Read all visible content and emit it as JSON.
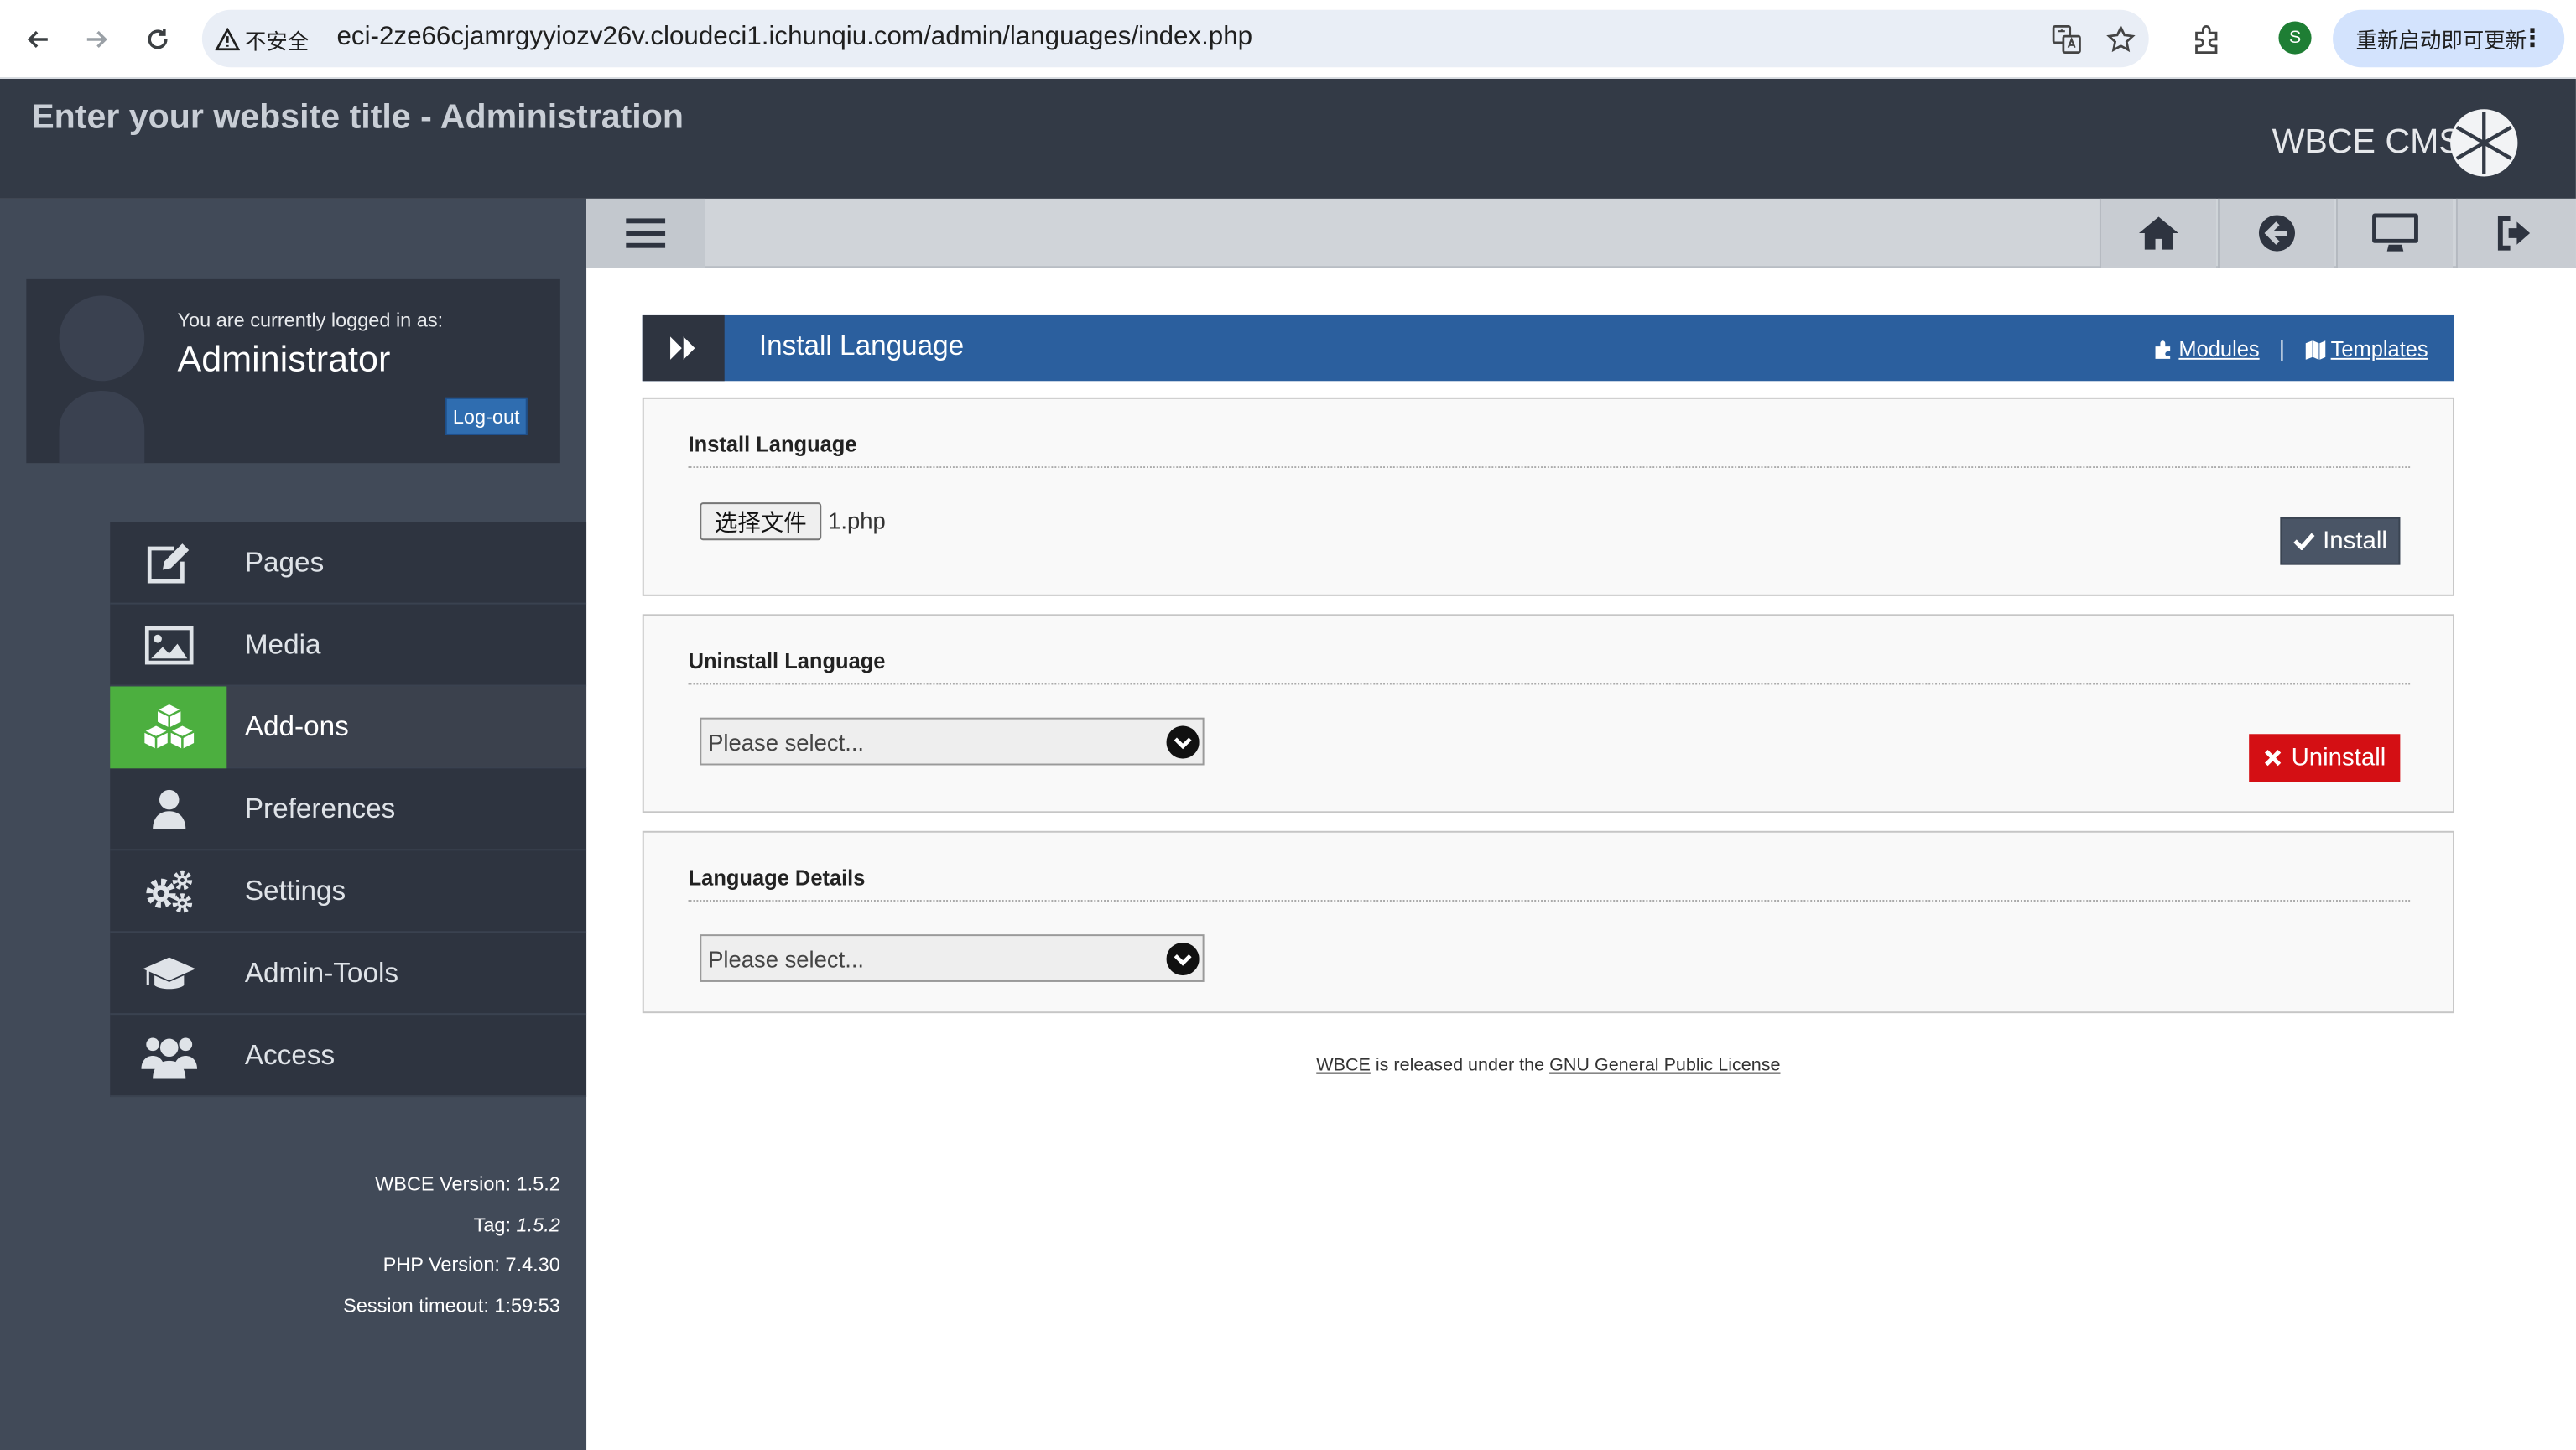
{
  "browser": {
    "security_label": "不安全",
    "url": "eci-2ze66cjamrgyyiozv26v.cloudeci1.ichunqiu.com/admin/languages/index.php",
    "profile_initial": "S",
    "update_label": "重新启动即可更新"
  },
  "header": {
    "site_title": "Enter your website title - Administration",
    "brand": "WBCE CMS"
  },
  "user": {
    "logged_in_label": "You are currently logged in as:",
    "name": "Administrator",
    "logout_label": "Log-out"
  },
  "menu": [
    {
      "label": "Pages",
      "icon": "edit-icon",
      "active": false
    },
    {
      "label": "Media",
      "icon": "image-icon",
      "active": false
    },
    {
      "label": "Add-ons",
      "icon": "cubes-icon",
      "active": true
    },
    {
      "label": "Preferences",
      "icon": "user-icon",
      "active": false
    },
    {
      "label": "Settings",
      "icon": "gears-icon",
      "active": false
    },
    {
      "label": "Admin-Tools",
      "icon": "graduation-cap-icon",
      "active": false
    },
    {
      "label": "Access",
      "icon": "users-icon",
      "active": false
    }
  ],
  "version": {
    "wbce_label": "WBCE Version: 1.5.2",
    "tag_label": "Tag: ",
    "tag_value": "1.5.2",
    "php_label": "PHP Version: 7.4.30",
    "session_label": "Session timeout: 1:59:53"
  },
  "page": {
    "title": "Install Language",
    "modules_link": "Modules",
    "separator": "|",
    "templates_link": "Templates"
  },
  "install": {
    "heading": "Install Language",
    "file_button": "选择文件",
    "file_name": "1.php",
    "install_button": "Install"
  },
  "uninstall": {
    "heading": "Uninstall Language",
    "select_value": "Please select...",
    "uninstall_button": "Uninstall"
  },
  "details": {
    "heading": "Language Details",
    "select_value": "Please select..."
  },
  "footer": {
    "wbce_link": "WBCE",
    "text": " is released under the ",
    "license_link": "GNU General Public License"
  },
  "colors": {
    "header_bg": "#333a46",
    "sidebar_bg": "#414a58",
    "title_bar": "#2b5f9e",
    "active_green": "#4caf3f",
    "uninstall_red": "#d40f14"
  }
}
